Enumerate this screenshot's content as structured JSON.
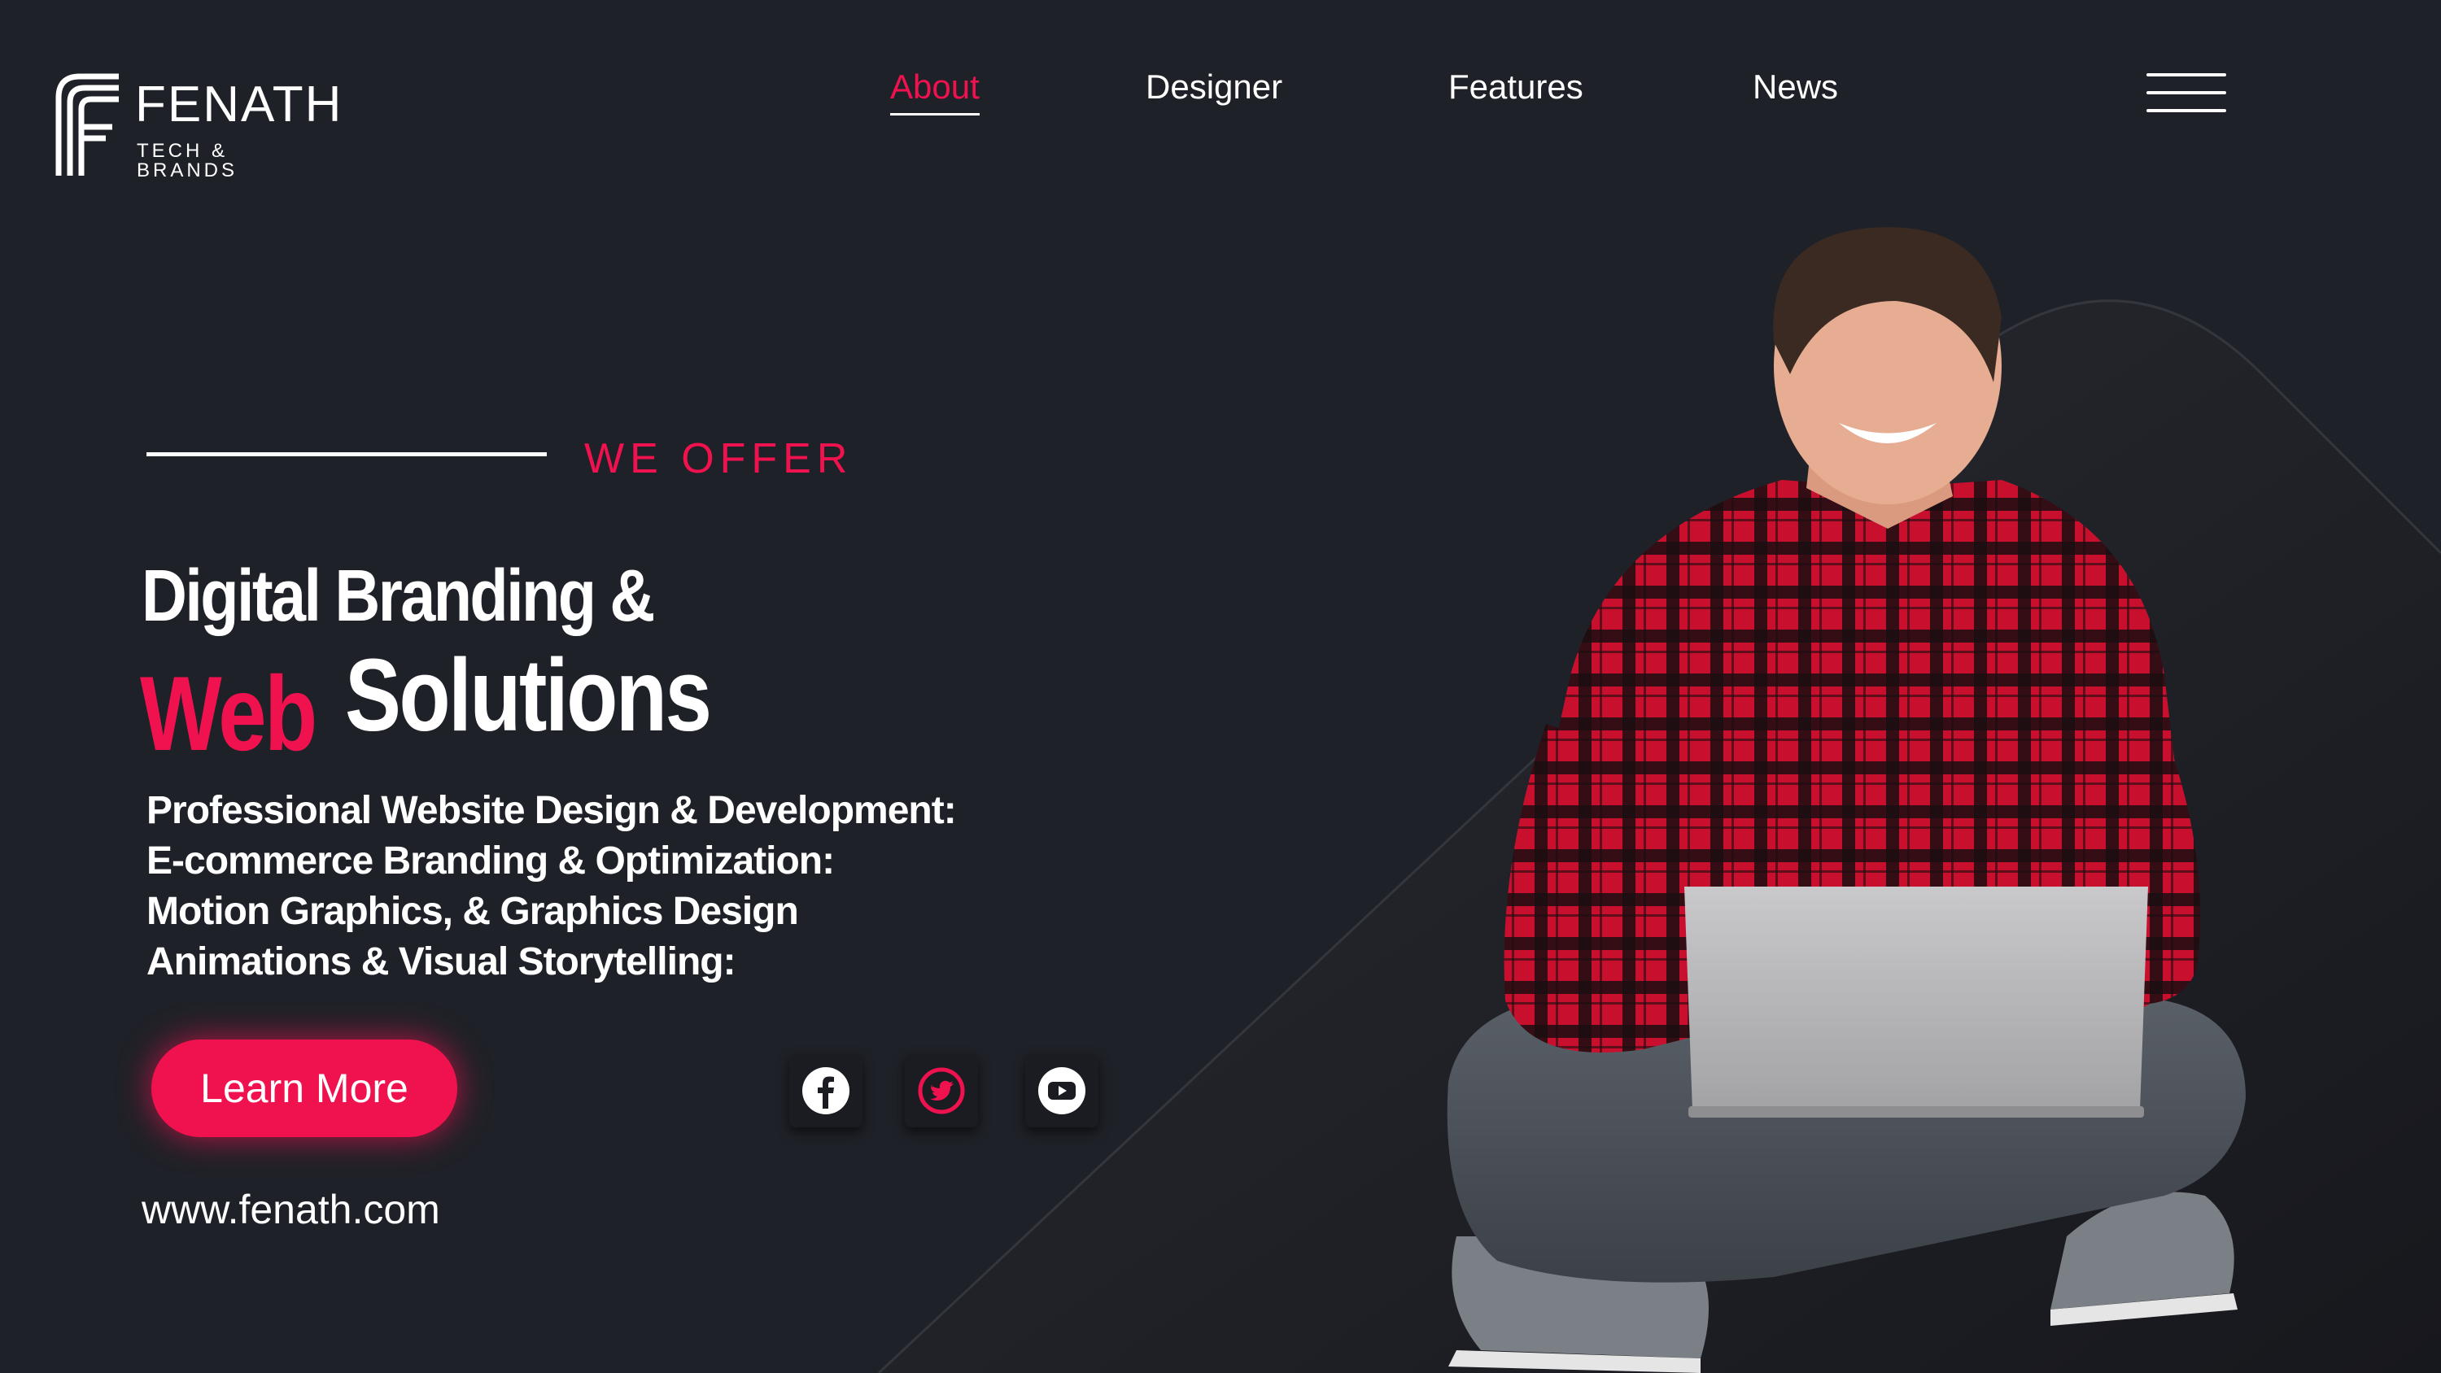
{
  "brand": {
    "name": "FENATH",
    "tagline": "TECH & BRANDS"
  },
  "nav": {
    "items": [
      {
        "label": "About",
        "active": true
      },
      {
        "label": "Designer",
        "active": false
      },
      {
        "label": "Features",
        "active": false
      },
      {
        "label": "News",
        "active": false
      }
    ],
    "menu_icon": "hamburger-menu-icon"
  },
  "hero": {
    "eyebrow": "WE OFFER",
    "title_line1": "Digital Branding &",
    "title_highlight": "Web",
    "title_rest": "Solutions",
    "services": [
      "Professional Website Design & Development:",
      "E-commerce Branding & Optimization:",
      "Motion Graphics, & Graphics Design",
      "Animations & Visual Storytelling:"
    ],
    "cta_label": "Learn More",
    "website": "www.fenath.com"
  },
  "social": [
    {
      "icon": "facebook-icon"
    },
    {
      "icon": "twitter-icon"
    },
    {
      "icon": "youtube-icon"
    }
  ],
  "colors": {
    "background": "#1f2128",
    "accent": "#f0124e",
    "text": "#ffffff"
  }
}
